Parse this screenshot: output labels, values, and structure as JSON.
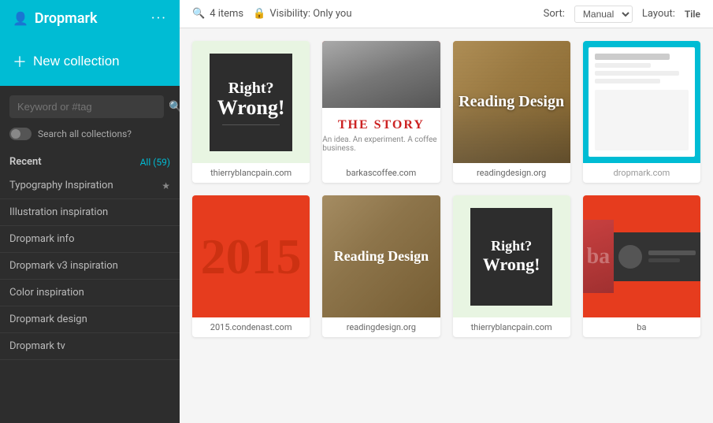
{
  "sidebar": {
    "brand_label": "Dropmark",
    "brand_icon": "▣",
    "dots": "···",
    "new_collection_label": "New collection",
    "search_placeholder": "Keyword or #tag",
    "search_all_label": "Search all collections?",
    "recent_label": "Recent",
    "all_count_label": "All (59)",
    "collections": [
      {
        "name": "Typography Inspiration",
        "starred": true
      },
      {
        "name": "Illustration inspiration",
        "starred": false
      },
      {
        "name": "Dropmark info",
        "starred": false
      },
      {
        "name": "Dropmark v3 inspiration",
        "starred": false
      },
      {
        "name": "Color inspiration",
        "starred": false
      },
      {
        "name": "Dropmark design",
        "starred": false
      },
      {
        "name": "Dropmark tv",
        "starred": false
      }
    ]
  },
  "toolbar": {
    "items_count": "4 items",
    "visibility": "Visibility: Only you",
    "sort_label": "Sort:",
    "sort_value": "Manual",
    "layout_label": "Layout:",
    "layout_value": "Tile"
  },
  "grid": {
    "items": [
      {
        "url": "thierryblancpain.com",
        "type": "thierry1"
      },
      {
        "url": "barkascoffee.com",
        "type": "barkas"
      },
      {
        "url": "readingdesign.org",
        "type": "reading1"
      },
      {
        "url": "",
        "type": "partial1"
      },
      {
        "url": "2015.condenast.com",
        "type": "year2015"
      },
      {
        "url": "readingdesign.org",
        "type": "reading2"
      },
      {
        "url": "thierryblancpain.com",
        "type": "thierry2"
      },
      {
        "url": "ba",
        "type": "partial2"
      }
    ]
  }
}
